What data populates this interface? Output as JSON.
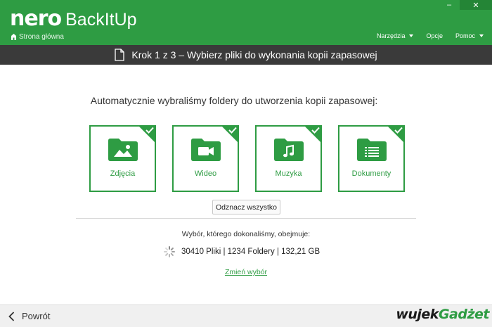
{
  "header": {
    "logo_brand": "nero",
    "logo_product": "BackItUp",
    "home_label": "Strona główna",
    "menu": [
      {
        "label": "Narzędzia"
      },
      {
        "label": "Opcje"
      },
      {
        "label": "Pomoc"
      }
    ],
    "window_controls": {
      "minimize": "–",
      "close": "✕"
    }
  },
  "stepbar": {
    "title": "Krok 1 z 3 – Wybierz pliki do wykonania kopii zapasowej"
  },
  "main": {
    "headline": "Automatycznie wybraliśmy foldery do utworzenia kopii zapasowej:",
    "tiles": [
      {
        "label": "Zdjęcia",
        "icon": "photo-folder-icon",
        "checked": true
      },
      {
        "label": "Wideo",
        "icon": "video-folder-icon",
        "checked": true
      },
      {
        "label": "Muzyka",
        "icon": "music-folder-icon",
        "checked": true
      },
      {
        "label": "Dokumenty",
        "icon": "document-folder-icon",
        "checked": true
      }
    ],
    "select_all_label": "Odznacz wszystko",
    "summary_label": "Wybór, którego dokonaliśmy, obejmuje:",
    "stats": "30410 Pliki | 1234 Foldery | 132,21 GB",
    "change_link": "Zmień wybór"
  },
  "footer": {
    "back_label": "Powrót",
    "watermark_a": "wujek",
    "watermark_b": "Gadżet"
  },
  "colors": {
    "accent": "#2e9c43",
    "stepbar": "#3a3a3a",
    "footer": "#f0f0f0"
  }
}
